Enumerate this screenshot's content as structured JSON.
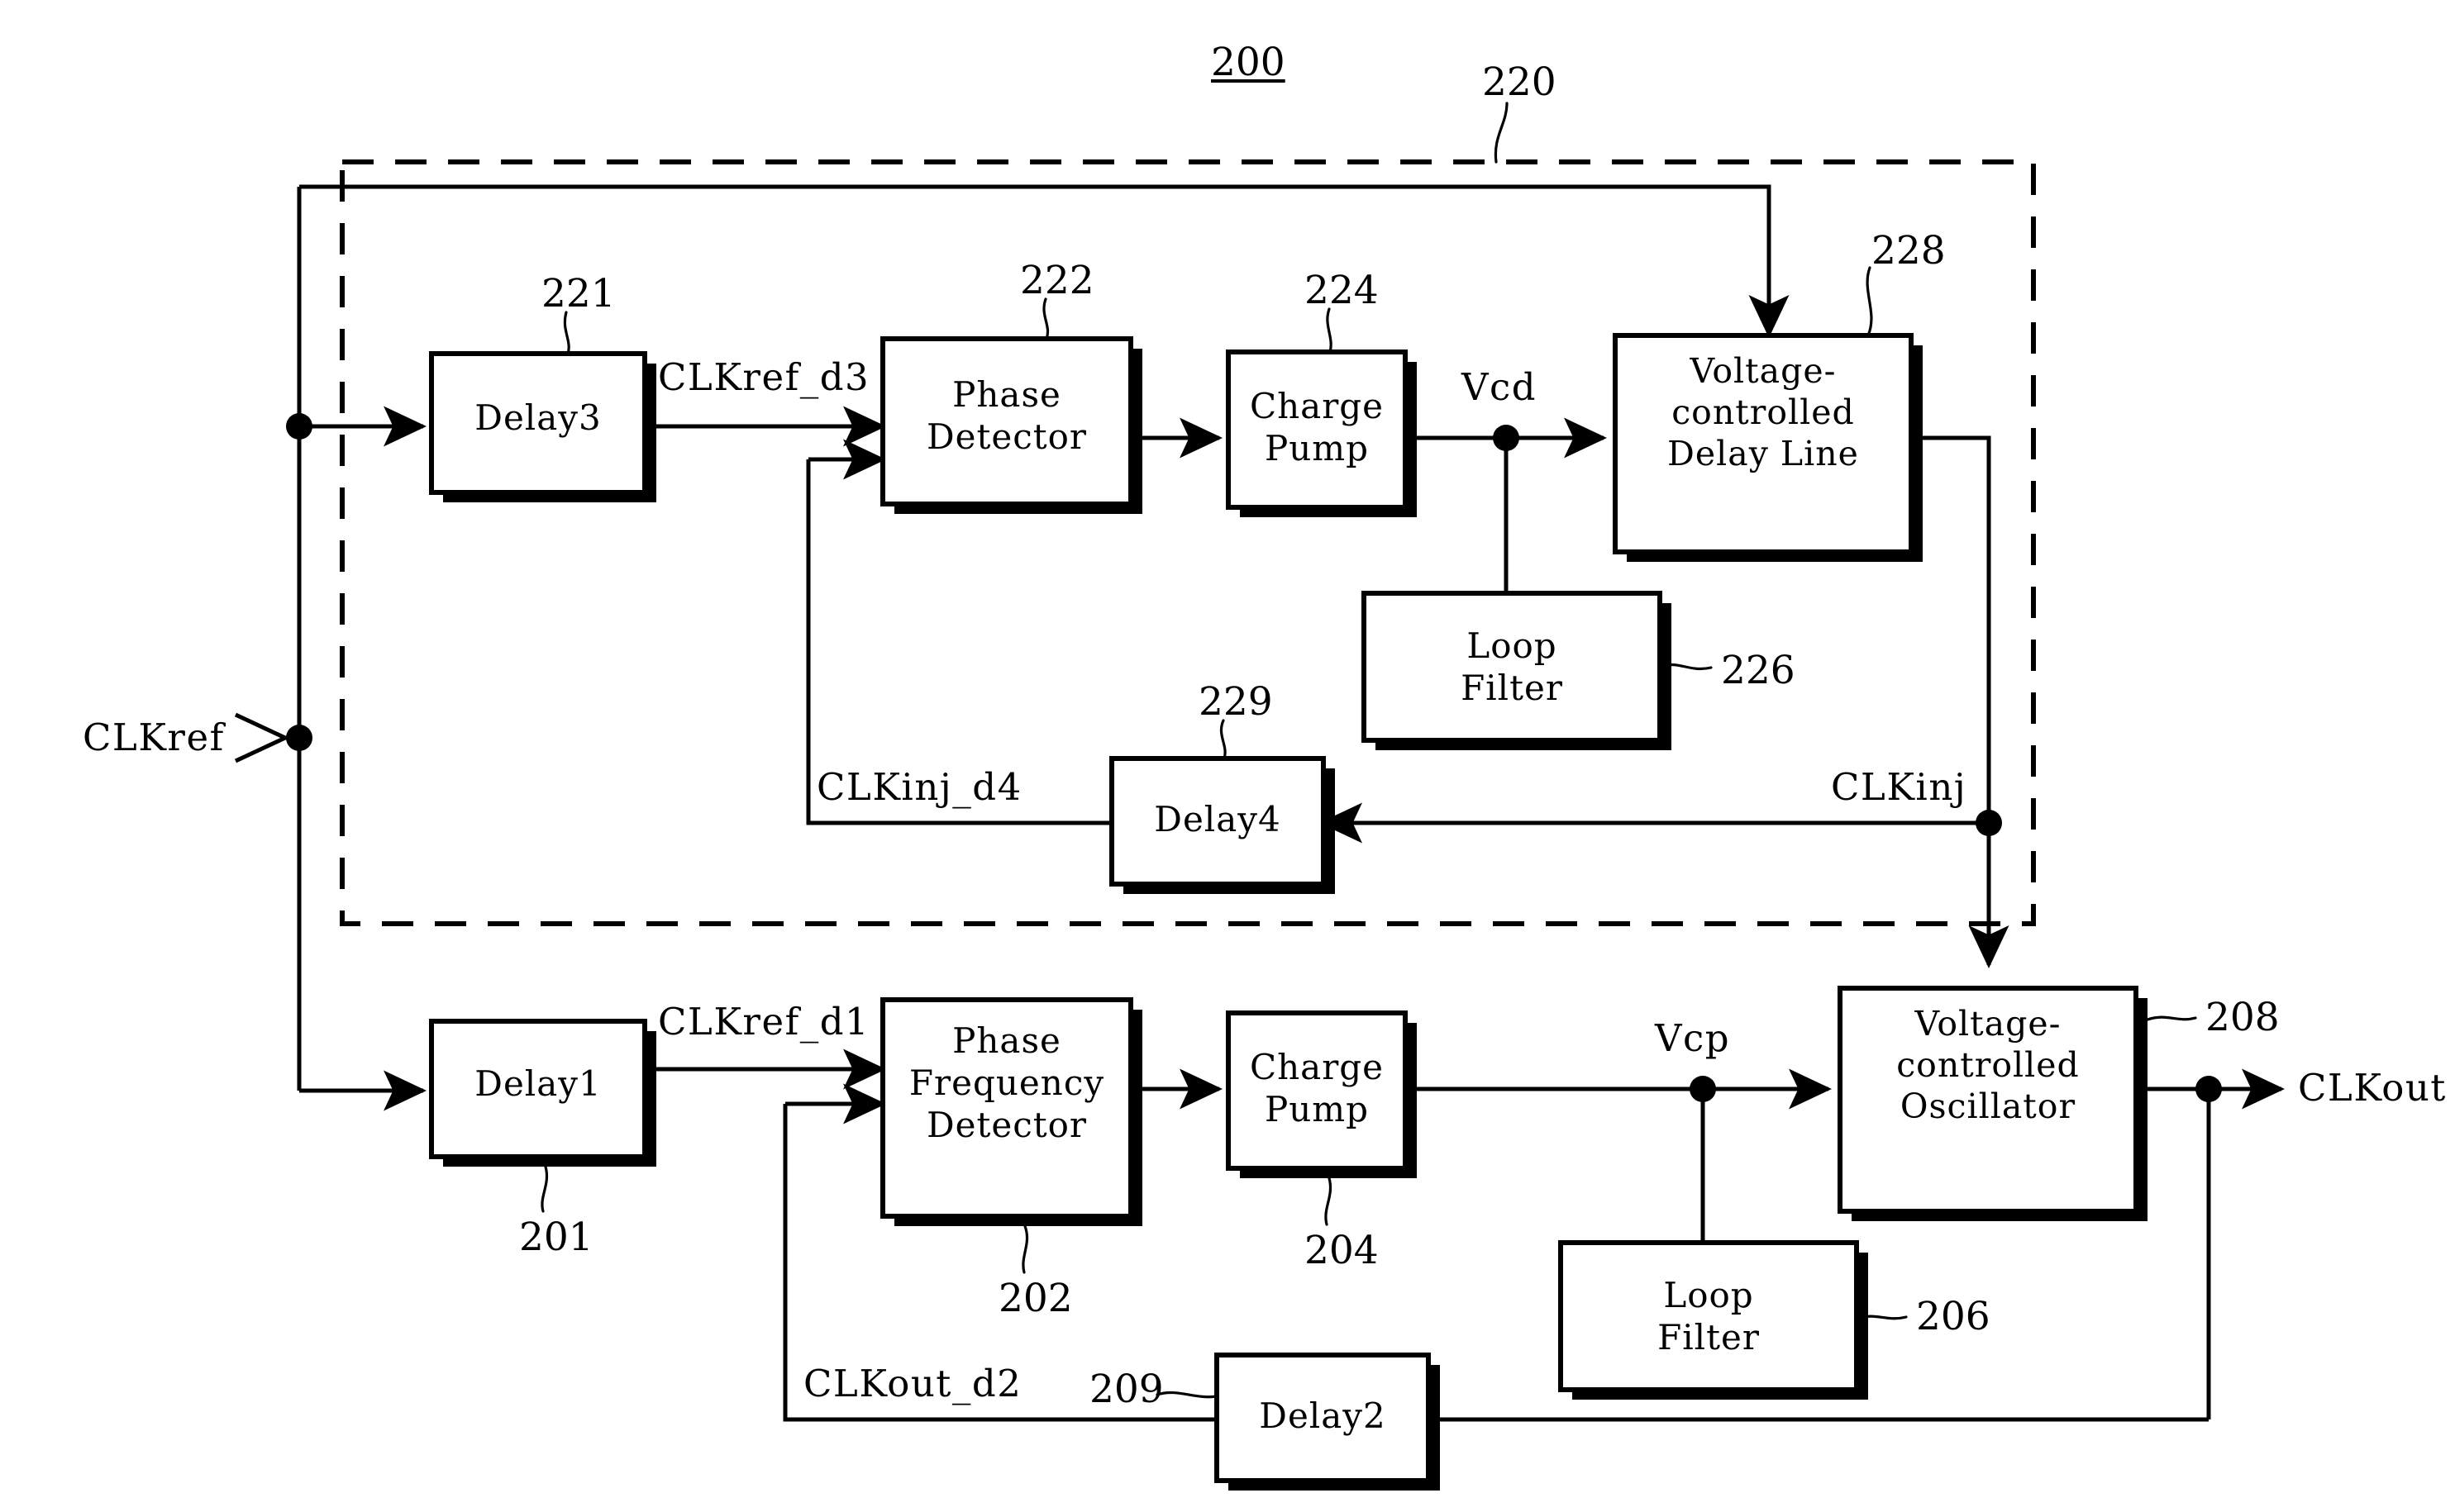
{
  "figure": {
    "ref_main": "200",
    "ref_dashed_block": "220"
  },
  "ports": {
    "input": {
      "label": "CLKref"
    },
    "output": {
      "label": "CLKout"
    }
  },
  "blocks": [
    {
      "id": "delay3",
      "label": "Delay3",
      "ref": "221"
    },
    {
      "id": "pd",
      "label": "Phase\nDetector",
      "ref": "222"
    },
    {
      "id": "cp_top",
      "label": "Charge\nPump",
      "ref": "224"
    },
    {
      "id": "vcdl",
      "label": "Voltage-\ncontrolled\nDelay Line",
      "ref": "228"
    },
    {
      "id": "lf_top",
      "label": "Loop\nFilter",
      "ref": "226"
    },
    {
      "id": "delay4",
      "label": "Delay4",
      "ref": "229"
    },
    {
      "id": "delay1",
      "label": "Delay1",
      "ref": "201"
    },
    {
      "id": "pfd",
      "label": "Phase\nFrequency\nDetector",
      "ref": "202"
    },
    {
      "id": "cp_bot",
      "label": "Charge\nPump",
      "ref": "204"
    },
    {
      "id": "vco",
      "label": "Voltage-\ncontrolled\nOscillator",
      "ref": "208"
    },
    {
      "id": "lf_bot",
      "label": "Loop\nFilter",
      "ref": "206"
    },
    {
      "id": "delay2",
      "label": "Delay2",
      "ref": "209"
    }
  ],
  "signals": {
    "clkref_d3": "CLKref_d3",
    "vcd": "Vcd",
    "clkinj_d4": "CLKinj_d4",
    "clkinj": "CLKinj",
    "clkref_d1": "CLKref_d1",
    "vcp": "Vcp",
    "clkout_d2": "CLKout_d2"
  },
  "colors": {
    "line": "#000000",
    "background": "#ffffff"
  }
}
